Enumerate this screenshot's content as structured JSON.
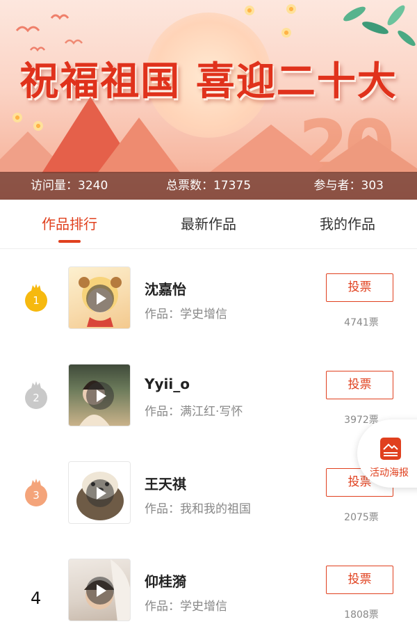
{
  "banner": {
    "title": "祝福祖国 喜迎二十大",
    "big_number": "20"
  },
  "stats": {
    "visits": "访问量：3240",
    "total_votes": "总票数：17375",
    "participants": "参与者：303"
  },
  "tabs": [
    {
      "label": "作品排行",
      "active": true
    },
    {
      "label": "最新作品",
      "active": false
    },
    {
      "label": "我的作品",
      "active": false
    }
  ],
  "entries": [
    {
      "rank": "1",
      "name": "沈嘉怡",
      "work": "作品：学史增信",
      "vote_label": "投票",
      "votes": "4741票",
      "medal_color": "#f6b90f"
    },
    {
      "rank": "2",
      "name": "Yyii_o",
      "work": "作品：满江红·写怀",
      "vote_label": "投票",
      "votes": "3972票",
      "medal_color": "#c9c9c9"
    },
    {
      "rank": "3",
      "name": "王天祺",
      "work": "作品：我和我的祖国",
      "vote_label": "投票",
      "votes": "2075票",
      "medal_color": "#f4a47a"
    },
    {
      "rank": "4",
      "name": "仰桂漪",
      "work": "作品：学史增信",
      "vote_label": "投票",
      "votes": "1808票"
    }
  ],
  "poster": {
    "label": "活动海报"
  },
  "colors": {
    "accent": "#e0401e",
    "banner_text": "#e0321c",
    "stats_bar": "#6e3a30"
  }
}
